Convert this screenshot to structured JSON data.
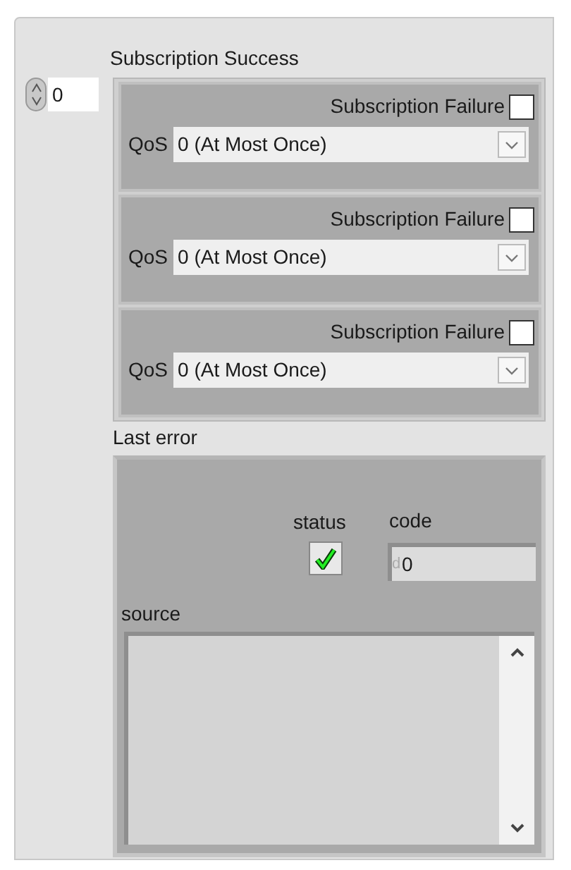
{
  "index": {
    "value": "0"
  },
  "array": {
    "label": "Subscription Success",
    "elements": [
      {
        "failure_label": "Subscription Failure",
        "failure": false,
        "qos_label": "QoS",
        "qos": "0 (At Most Once)"
      },
      {
        "failure_label": "Subscription Failure",
        "failure": false,
        "qos_label": "QoS",
        "qos": "0 (At Most Once)"
      },
      {
        "failure_label": "Subscription Failure",
        "failure": false,
        "qos_label": "QoS",
        "qos": "0 (At Most Once)"
      }
    ]
  },
  "last_error": {
    "label": "Last error",
    "status_label": "status",
    "status": false,
    "code_label": "code",
    "code_radix": "d",
    "code": "0",
    "source_label": "source"
  }
}
